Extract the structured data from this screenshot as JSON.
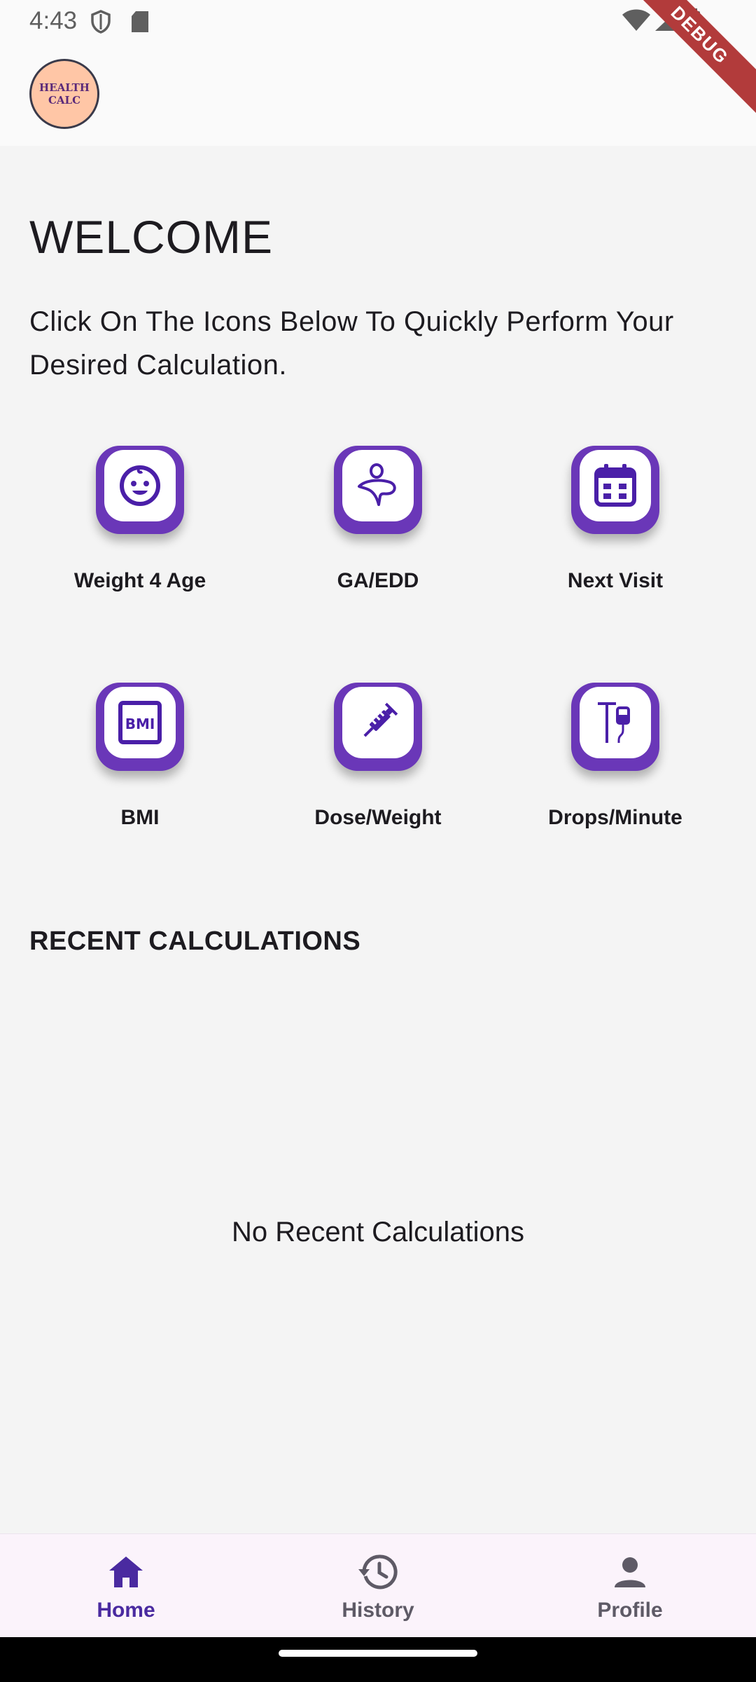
{
  "status_bar": {
    "time": "4:43"
  },
  "app_bar": {
    "logo_line1": "HEALTH",
    "logo_line2": "CALC",
    "debug_banner": "DEBUG"
  },
  "main": {
    "title": "WELCOME",
    "subtitle": "Click On The Icons Below To Quickly Perform Your Desired Calculation.",
    "calculators": [
      {
        "label": "Weight 4 Age",
        "icon": "baby-face-icon"
      },
      {
        "label": "GA/EDD",
        "icon": "pregnancy-icon"
      },
      {
        "label": "Next Visit",
        "icon": "calendar-icon"
      },
      {
        "label": "BMI",
        "icon": "bmi-icon"
      },
      {
        "label": "Dose/Weight",
        "icon": "syringe-icon"
      },
      {
        "label": "Drops/Minute",
        "icon": "iv-drip-icon"
      }
    ],
    "recent_title": "RECENT CALCULATIONS",
    "empty_message": "No Recent Calculations"
  },
  "bottom_nav": {
    "items": [
      {
        "label": "Home",
        "icon": "home-icon",
        "active": true
      },
      {
        "label": "History",
        "icon": "history-icon",
        "active": false
      },
      {
        "label": "Profile",
        "icon": "person-icon",
        "active": false
      }
    ]
  },
  "colors": {
    "accent": "#6a37b8",
    "icon_purple": "#4a1fa8",
    "nav_active": "#4a2aa0",
    "nav_inactive": "#5e5a66",
    "nav_bg": "#fbf3fb",
    "logo_bg": "#ffc6a6"
  }
}
